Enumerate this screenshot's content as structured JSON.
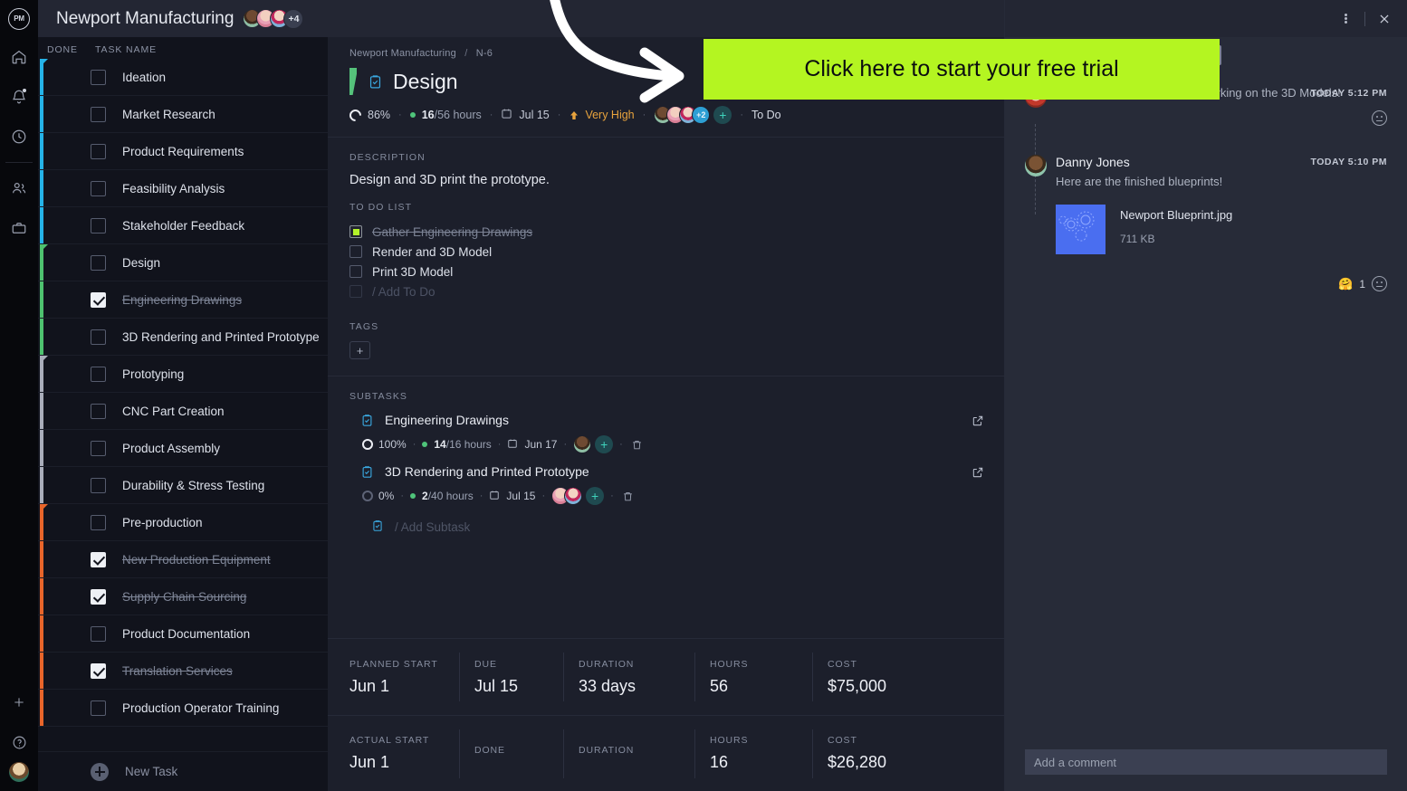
{
  "overlay": {
    "banner_text": "Click here to start your free trial",
    "banner_bg": "#b4f521",
    "arrow_icon": "curved-arrow-icon"
  },
  "rail": {
    "logo_text": "PM",
    "icons": [
      {
        "name": "home-icon",
        "label": "Home"
      },
      {
        "name": "bell-icon",
        "label": "Notifications"
      },
      {
        "name": "clock-icon",
        "label": "Time"
      },
      {
        "name": "people-icon",
        "label": "Team"
      },
      {
        "name": "briefcase-icon",
        "label": "Portfolio"
      }
    ],
    "bottom_icons": [
      {
        "name": "plus-icon",
        "label": "Add"
      },
      {
        "name": "help-icon",
        "label": "Help"
      }
    ],
    "avatar_name": "user-avatar"
  },
  "list": {
    "project_title": "Newport Manufacturing",
    "avatar_overflow": "+4",
    "columns": {
      "done": "DONE",
      "task": "TASK NAME"
    },
    "new_task_label": "New Task",
    "tasks": [
      {
        "name": "Ideation",
        "done": false,
        "strip": "#25b3e8",
        "cap": true,
        "milestone": false
      },
      {
        "name": "Market Research",
        "done": false,
        "strip": "#25b3e8",
        "cap": false,
        "milestone": false
      },
      {
        "name": "Product Requirements",
        "done": false,
        "strip": "#25b3e8",
        "cap": false,
        "milestone": false
      },
      {
        "name": "Feasibility Analysis",
        "done": false,
        "strip": "#25b3e8",
        "cap": false,
        "milestone": false
      },
      {
        "name": "Stakeholder Feedback",
        "done": false,
        "strip": "#25b3e8",
        "cap": false,
        "milestone": true
      },
      {
        "name": "Design",
        "done": false,
        "strip": "#4ec26f",
        "cap": true,
        "milestone": false
      },
      {
        "name": "Engineering Drawings",
        "done": true,
        "strip": "#4ec26f",
        "cap": false,
        "milestone": false
      },
      {
        "name": "3D Rendering and Printed Prototype",
        "done": false,
        "strip": "#4ec26f",
        "cap": false,
        "milestone": false
      },
      {
        "name": "Prototyping",
        "done": false,
        "strip": "#a9adba",
        "cap": true,
        "milestone": false
      },
      {
        "name": "CNC Part Creation",
        "done": false,
        "strip": "#a9adba",
        "cap": false,
        "milestone": false
      },
      {
        "name": "Product Assembly",
        "done": false,
        "strip": "#a9adba",
        "cap": false,
        "milestone": false
      },
      {
        "name": "Durability & Stress Testing",
        "done": false,
        "strip": "#a9adba",
        "cap": false,
        "milestone": false
      },
      {
        "name": "Pre-production",
        "done": false,
        "strip": "#e8652a",
        "cap": true,
        "milestone": false
      },
      {
        "name": "New Production Equipment",
        "done": true,
        "strip": "#e8652a",
        "cap": false,
        "milestone": false
      },
      {
        "name": "Supply Chain Sourcing",
        "done": true,
        "strip": "#e8652a",
        "cap": false,
        "milestone": false
      },
      {
        "name": "Product Documentation",
        "done": false,
        "strip": "#e8652a",
        "cap": false,
        "milestone": false
      },
      {
        "name": "Translation Services",
        "done": true,
        "strip": "#e8652a",
        "cap": false,
        "milestone": false
      },
      {
        "name": "Production Operator Training",
        "done": false,
        "strip": "#e8652a",
        "cap": false,
        "milestone": true
      }
    ]
  },
  "detail": {
    "breadcrumb": {
      "project": "Newport Manufacturing",
      "separator": "/",
      "id": "N-6"
    },
    "title": "Design",
    "meta": {
      "progress": "86%",
      "hours_done": "16",
      "hours_total": "/56 hours",
      "due_date": "Jul 15",
      "priority": "Very High",
      "assignee_overflow": "+2",
      "status": "To Do"
    },
    "description": {
      "label": "DESCRIPTION",
      "text": "Design and 3D print the prototype."
    },
    "todo": {
      "label": "TO DO LIST",
      "items": [
        {
          "text": "Gather Engineering Drawings",
          "done": true
        },
        {
          "text": "Render and 3D Model",
          "done": false
        },
        {
          "text": "Print 3D Model",
          "done": false
        }
      ],
      "add_placeholder": "/ Add To Do"
    },
    "tags": {
      "label": "TAGS",
      "add_label": "+"
    },
    "subtasks": {
      "label": "SUBTASKS",
      "items": [
        {
          "name": "Engineering Drawings",
          "progress": "100%",
          "hours_done": "14",
          "hours_total": "/16 hours",
          "date": "Jun 17",
          "avatars": 1
        },
        {
          "name": "3D Rendering and Printed Prototype",
          "progress": "0%",
          "hours_done": "2",
          "hours_total": "/40 hours",
          "date": "Jul 15",
          "avatars": 2
        }
      ],
      "add_placeholder": "/ Add Subtask"
    },
    "stats_planned": [
      {
        "key": "PLANNED START",
        "value": "Jun 1"
      },
      {
        "key": "DUE",
        "value": "Jul 15"
      },
      {
        "key": "DURATION",
        "value": "33 days"
      },
      {
        "key": "HOURS",
        "value": "56"
      },
      {
        "key": "COST",
        "value": "$75,000"
      }
    ],
    "stats_actual": [
      {
        "key": "ACTUAL START",
        "value": "Jun 1"
      },
      {
        "key": "DONE",
        "value": ""
      },
      {
        "key": "DURATION",
        "value": ""
      },
      {
        "key": "HOURS",
        "value": "16"
      },
      {
        "key": "COST",
        "value": "$26,280"
      }
    ]
  },
  "comments": {
    "items": [
      {
        "author": "",
        "time": "TODAY 5:12 PM",
        "text": "Thanks Danny, we will start working on the 3D Models!"
      },
      {
        "author": "Danny Jones",
        "time": "TODAY 5:10 PM",
        "text": "Here are the finished blueprints!"
      }
    ],
    "attachment": {
      "name": "Newport Blueprint.jpg",
      "size": "711 KB",
      "thumb_color": "#4a6ef0"
    },
    "reaction": {
      "emoji": "🤗",
      "count": "1"
    },
    "input_placeholder": "Add a comment",
    "kebab_icon": "more-vertical-icon",
    "close_icon": "close-icon"
  }
}
